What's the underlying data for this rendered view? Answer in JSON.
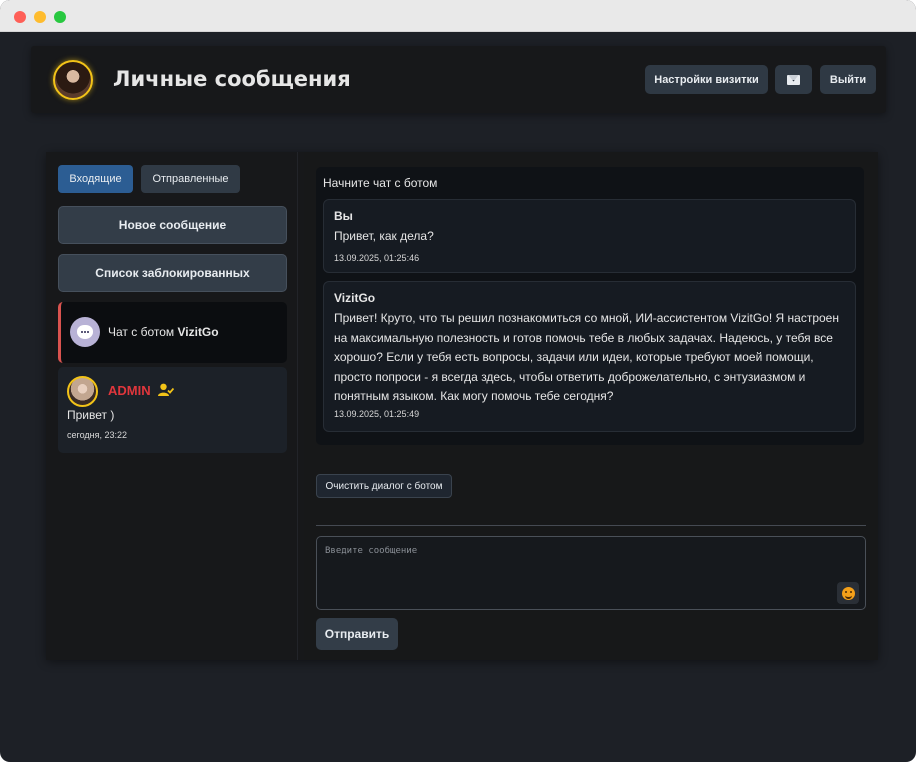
{
  "header": {
    "title": "Личные сообщения",
    "settings_label": "Настройки визитки",
    "mail_icon": "envelope-icon",
    "logout_label": "Выйти"
  },
  "sidebar": {
    "tabs": [
      {
        "label": "Входящие",
        "active": true
      },
      {
        "label": "Отправленные",
        "active": false
      }
    ],
    "new_message_label": "Новое сообщение",
    "blocked_list_label": "Список заблокированных",
    "bot_chat": {
      "prefix": "Чат с ботом ",
      "bot_name": "VizitGo"
    },
    "conversations": [
      {
        "name": "ADMIN",
        "last_message": "Привет )",
        "time": "сегодня, 23:22",
        "name_color": "#e0363c"
      }
    ]
  },
  "chat": {
    "hint": "Начните чат с ботом",
    "messages": [
      {
        "author": "Вы",
        "text": "Привет, как дела?",
        "time": "13.09.2025, 01:25:46"
      },
      {
        "author": "VizitGo",
        "text": "Привет! Круто, что ты решил познакомиться со мной, ИИ-ассистентом VizitGo! Я настроен на максимальную полезность и готов помочь тебе в любых задачах. Надеюсь, у тебя все хорошо? Если у тебя есть вопросы, задачи или идеи, которые требуют моей помощи, просто попроси - я всегда здесь, чтобы ответить доброжелательно, с энтузиазмом и понятным языком. Как могу помочь тебе сегодня?",
        "time": "13.09.2025, 01:25:49"
      }
    ],
    "clear_label": "Очистить диалог с ботом",
    "input_placeholder": "Введите сообщение",
    "send_label": "Отправить"
  },
  "colors": {
    "accent_tab": "#2c5d93",
    "avatar_ring": "#f2c318",
    "active_marker": "#d9534f"
  }
}
